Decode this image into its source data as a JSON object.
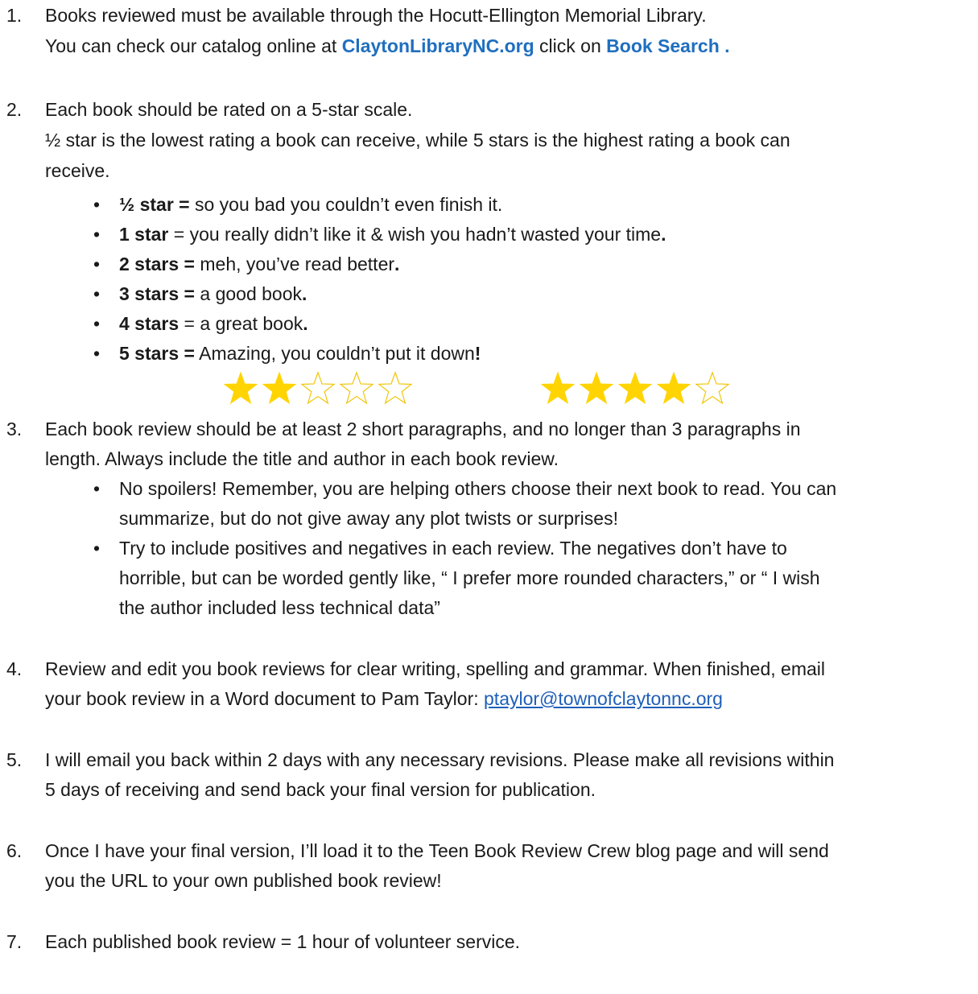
{
  "items": [
    {
      "num": "1.",
      "line1": "Books reviewed must be available through the Hocutt-Ellington Memorial Library.",
      "line2_pre": "You can check our catalog online at ",
      "link1": "ClaytonLibraryNC.org",
      "line2_mid": " click on ",
      "link2": "Book Search ."
    },
    {
      "num": "2.",
      "line1": "Each book should be rated on a 5-star scale.",
      "line2": "½ star is the lowest rating a book can receive, while 5 stars is the highest rating a book can",
      "line3": "receive.",
      "bullets": [
        {
          "label": " ½ star =",
          "text": " so you bad you couldn’t even finish it.",
          "end": ""
        },
        {
          "label": "1 star",
          "text": " = you really didn’t like it & wish you hadn’t wasted your time",
          "end": "."
        },
        {
          "label": "2 stars =",
          "text": " meh, you’ve read better",
          "end": "."
        },
        {
          "label": "3 stars =",
          "text": " a good book",
          "end": "."
        },
        {
          "label": "4 stars",
          "text": " = a great book",
          "end": "."
        },
        {
          "label": "5 stars =",
          "text": " Amazing, you couldn’t put it down",
          "end": "!"
        }
      ]
    },
    {
      "num": "3.",
      "line1": "Each book review should be at least 2 short paragraphs, and no longer than 3 paragraphs in",
      "line2": "length.  Always include the title and author in each book review.",
      "bullets": [
        {
          "l1": "No spoilers!  Remember, you are helping others choose their next book to read. You can",
          "l2": "summarize, but do not give away any plot twists or surprises!"
        },
        {
          "l1": "Try to include positives and negatives in each review. The negatives don’t have to",
          "l2": "horrible, but can be worded gently like, “ I prefer more rounded characters,” or “ I wish",
          "l3": "the author included less technical data”"
        }
      ]
    },
    {
      "num": "4.",
      "line1": "Review and edit you book reviews for clear writing, spelling and grammar. When finished, email",
      "line2_pre": "your book review in a Word document to Pam Taylor: ",
      "email": "ptaylor@townofclaytonnc.org"
    },
    {
      "num": "5.",
      "line1": "I will email you back within 2 days with any necessary revisions. Please make all revisions within",
      "line2": "5 days of receiving and send back your final version for publication."
    },
    {
      "num": "6.",
      "line1": "Once I have your final version, I’ll load it to the Teen Book Review Crew blog page and will send",
      "line2": "you the URL to your own published book review!"
    },
    {
      "num": "7.",
      "line1": "Each published book review = 1 hour of volunteer service."
    }
  ],
  "star_examples": [
    {
      "filled": 2,
      "total": 5
    },
    {
      "filled": 4,
      "total": 5
    }
  ],
  "colors": {
    "star_fill": "#ffd400",
    "star_outline": "#f0c400",
    "link": "#1f6fbf"
  }
}
